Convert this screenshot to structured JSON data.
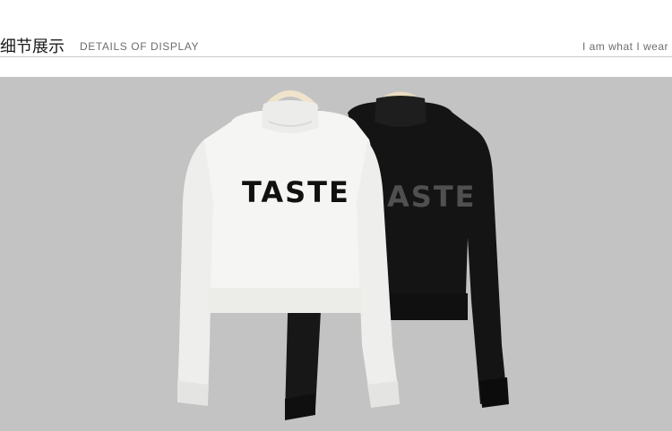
{
  "header": {
    "title_cn": "细节展示",
    "title_en": "DETAILS OF DISPLAY",
    "tagline": "I am what I wear"
  },
  "photo": {
    "white_sweater_print": "TASTE",
    "black_sweater_print": "ASTE",
    "colors": {
      "background": "#c3c3c3",
      "white_sweater": "#f4f4f2",
      "black_sweater": "#141414",
      "hanger": "#efe3cc"
    }
  }
}
